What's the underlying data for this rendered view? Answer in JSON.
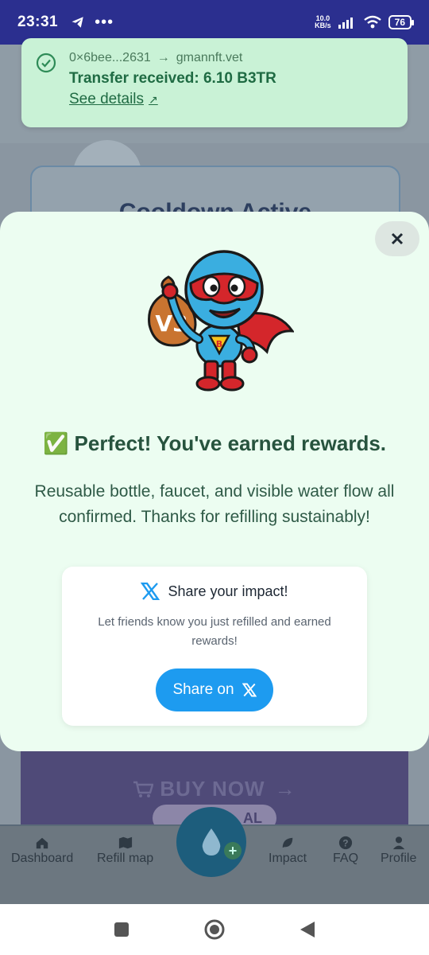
{
  "status_bar": {
    "time": "23:31",
    "net_speed_value": "10.0",
    "net_speed_unit": "KB/s",
    "battery": "76"
  },
  "toast": {
    "from": "0×6bee...2631",
    "arrow": "→",
    "to": "gmannft.vet",
    "title": "Transfer received: 6.10 B3TR",
    "link": "See details",
    "link_icon": "↗"
  },
  "background": {
    "card_title": "Cooldown Active",
    "buy_now": "BUY NOW",
    "pill_text": "AL",
    "nav": {
      "dashboard": "Dashboard",
      "refill_map": "Refill map",
      "impact": "Impact",
      "faq": "FAQ",
      "profile": "Profile"
    }
  },
  "modal": {
    "headline": "✅ Perfect! You've earned rewards.",
    "body": "Reusable bottle, faucet, and visible water flow all confirmed. Thanks for refilling sustainably!",
    "share": {
      "title": "Share your impact!",
      "subtitle": "Let friends know you just refilled and earned rewards!",
      "button": "Share on"
    }
  },
  "colors": {
    "status_bar": "#2b2f8f",
    "toast_bg": "#c9f2d6",
    "modal_bg": "#ecfdf1",
    "heading": "#27533e",
    "x_blue": "#1d9bf0"
  },
  "icons": [
    "telegram-icon",
    "wifi-icon",
    "signal-icon",
    "battery-icon",
    "check-circle-icon",
    "close-icon",
    "x-logo-icon",
    "home-icon",
    "map-icon",
    "leaf-icon",
    "question-icon",
    "user-icon",
    "water-drop-icon",
    "cart-icon"
  ]
}
